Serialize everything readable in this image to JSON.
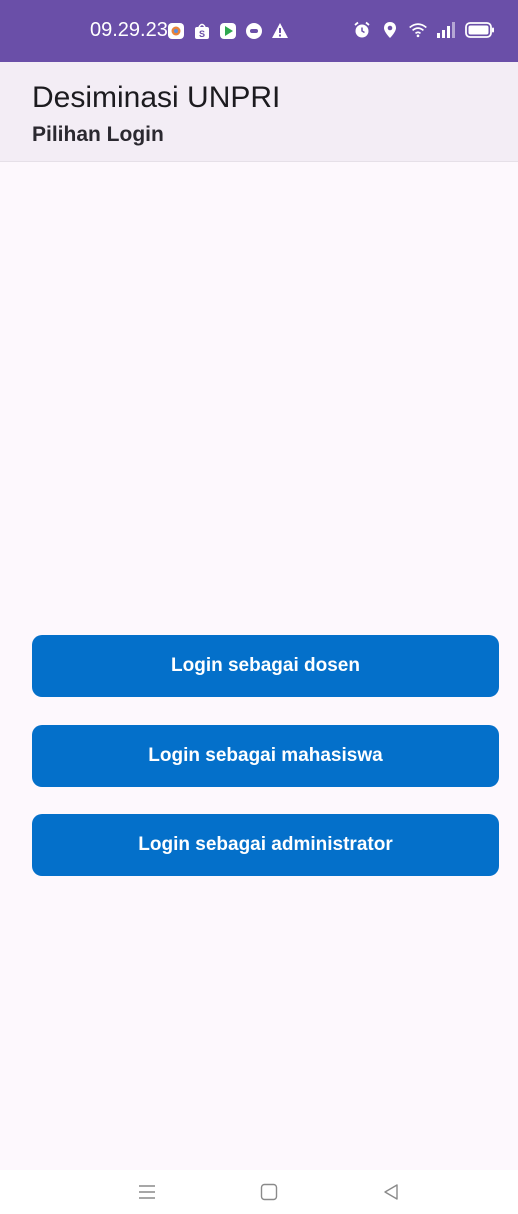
{
  "status_bar": {
    "time": "09.29.23",
    "background": "#6a4fa8",
    "notification_icons": [
      "photo-app-icon",
      "shopee-icon",
      "play-store-icon",
      "chat-icon",
      "warning-icon"
    ],
    "system_icons": [
      "alarm-icon",
      "location-icon",
      "wifi-icon",
      "signal-icon",
      "battery-icon"
    ]
  },
  "app_bar": {
    "title": "Desiminasi UNPRI",
    "subtitle": "Pilihan Login",
    "background": "#f3edf5"
  },
  "buttons": {
    "dosen_label": "Login sebagai dosen",
    "mahasiswa_label": "Login sebagai mahasiswa",
    "admin_label": "Login sebagai administrator",
    "color": "#0470ca"
  },
  "nav_bar": {
    "icons": [
      "menu-icon",
      "home-icon",
      "back-icon"
    ]
  }
}
